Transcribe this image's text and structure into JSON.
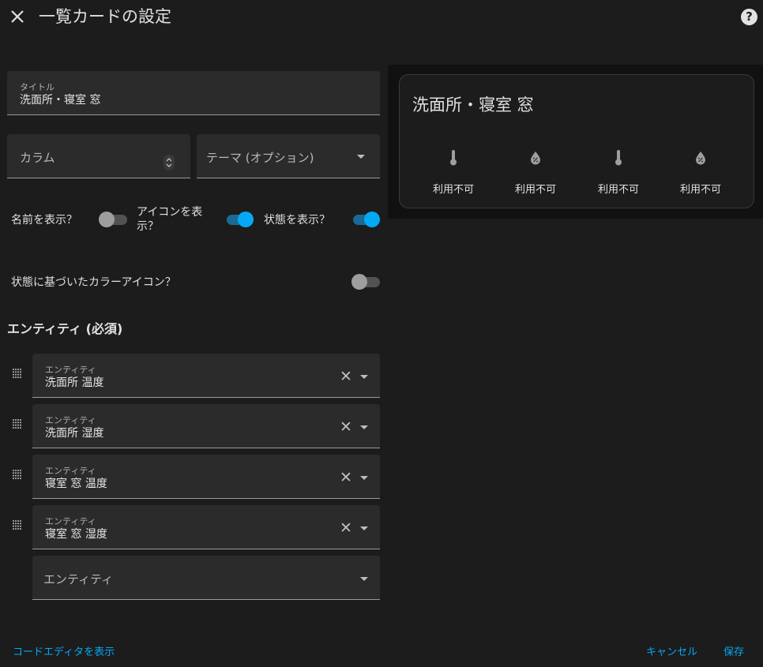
{
  "header": {
    "title": "一覧カードの設定",
    "close_icon": "close-icon",
    "help_icon": "help-circle-icon",
    "help_glyph": "?"
  },
  "form": {
    "title_field": {
      "label": "タイトル",
      "value": "洗面所・寝室 窓"
    },
    "columns_field": {
      "placeholder": "カラム"
    },
    "theme_field": {
      "placeholder": "テーマ (オプション)"
    },
    "toggles": {
      "show_name": {
        "label": "名前を表示？",
        "on": false
      },
      "show_icon": {
        "label": "アイコンを表示？",
        "on": true
      },
      "show_state": {
        "label": "状態を表示？",
        "on": true
      },
      "state_color": {
        "label": "状態に基づいたカラーアイコン？",
        "on": false
      }
    },
    "entities_title": "エンティティ (必須)",
    "entities": [
      {
        "label": "エンティティ",
        "value": "洗面所 温度"
      },
      {
        "label": "エンティティ",
        "value": "洗面所 湿度"
      },
      {
        "label": "エンティティ",
        "value": "寝室 窓 温度"
      },
      {
        "label": "エンティティ",
        "value": "寝室 窓 湿度"
      }
    ],
    "new_entity_placeholder": "エンティティ"
  },
  "preview": {
    "card_title": "洗面所・寝室 窓",
    "items": [
      {
        "icon": "thermometer-icon",
        "state": "利用不可"
      },
      {
        "icon": "water-percent-icon",
        "state": "利用不可"
      },
      {
        "icon": "thermometer-icon",
        "state": "利用不可"
      },
      {
        "icon": "water-percent-icon",
        "state": "利用不可"
      }
    ]
  },
  "footer": {
    "show_code_editor": "コードエディタを表示",
    "cancel": "キャンセル",
    "save": "保存"
  },
  "colors": {
    "background": "#1c1c1c",
    "accent": "#03a9f4",
    "field_bg": "#2b2b2b",
    "preview_bg": "#111111"
  }
}
